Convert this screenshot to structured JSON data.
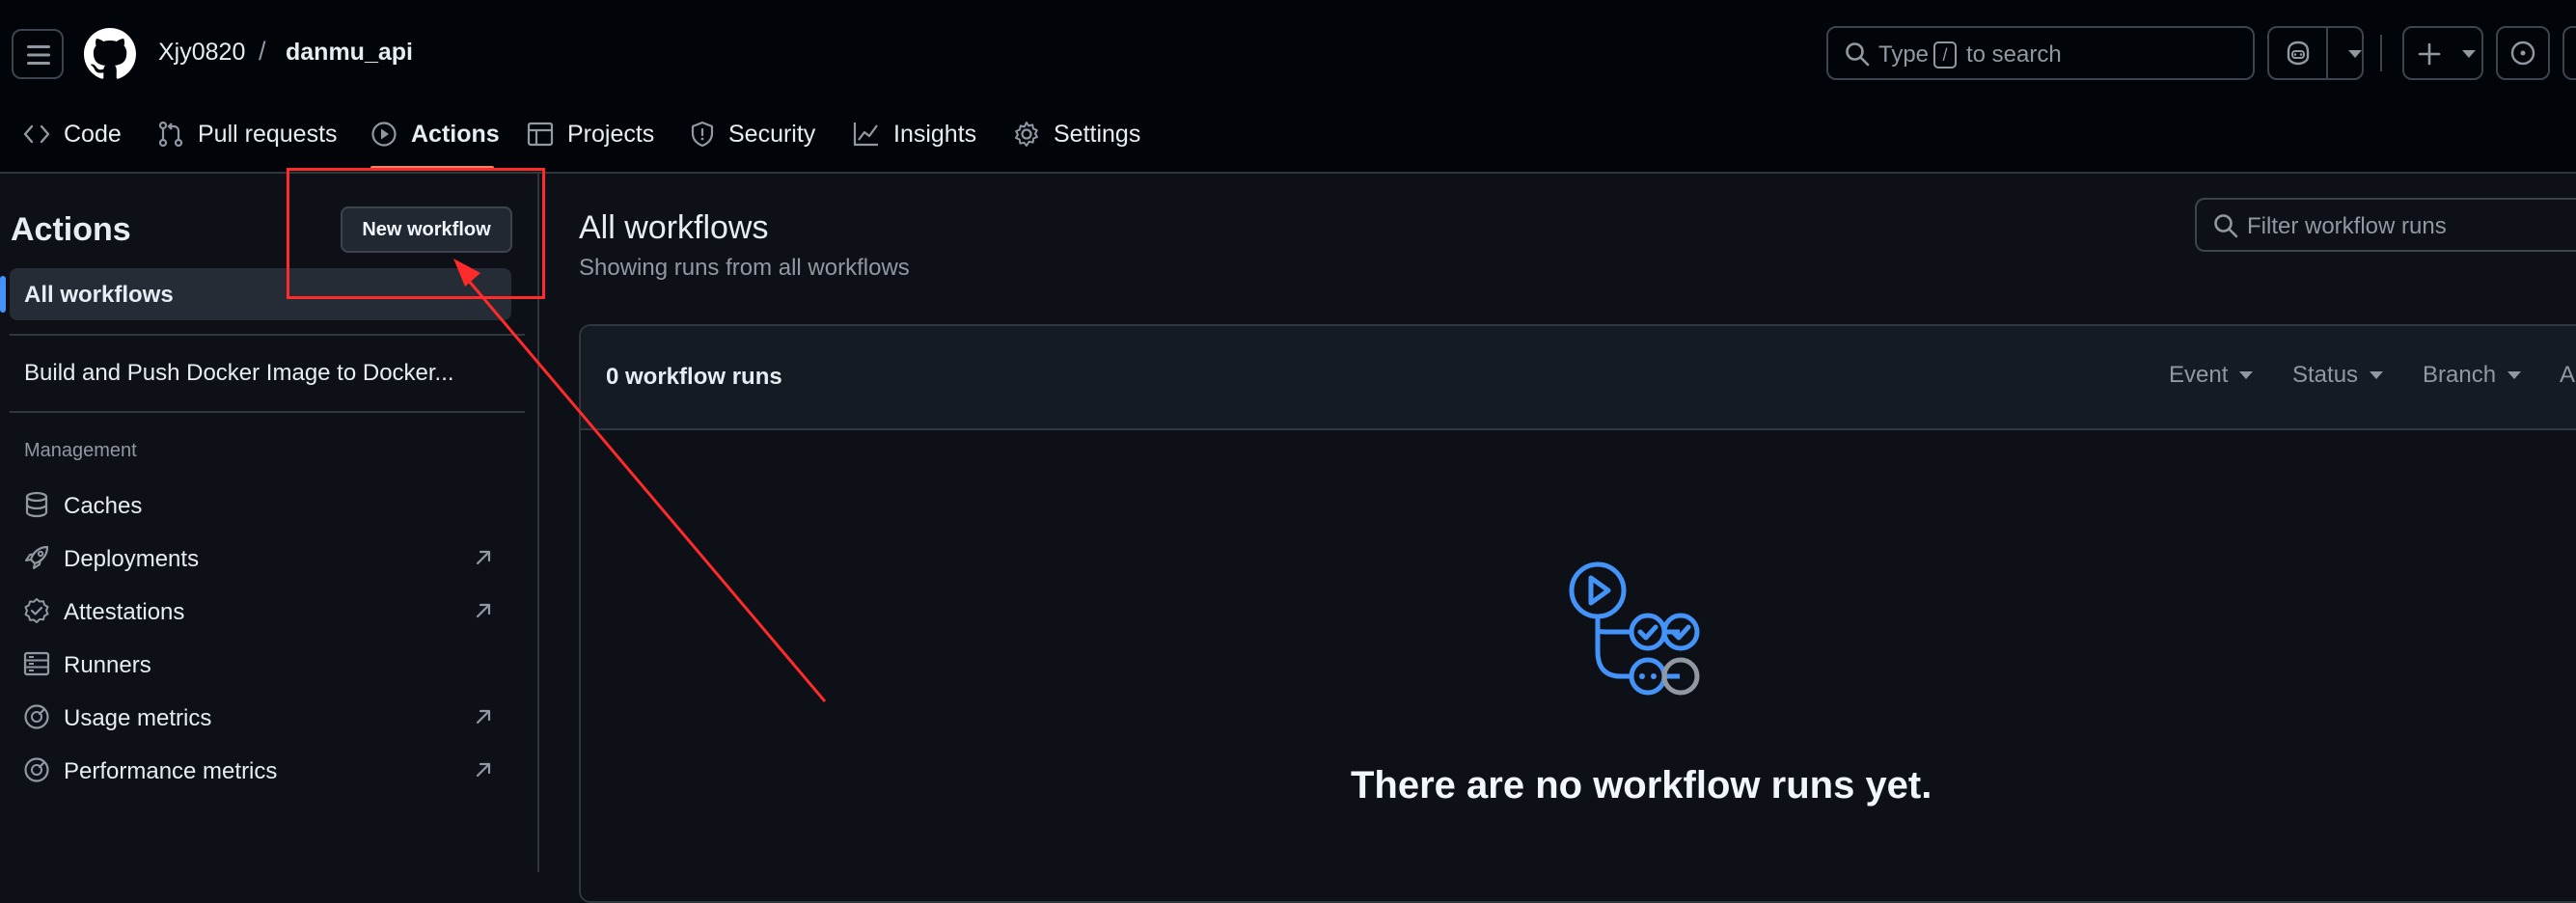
{
  "header": {
    "owner": "Xjy0820",
    "separator": "/",
    "repo": "danmu_api",
    "search_placeholder_pre": "Type",
    "search_key": "/",
    "search_placeholder_post": "to search"
  },
  "repo_nav": {
    "items": [
      {
        "label": "Code",
        "icon": "code-icon"
      },
      {
        "label": "Pull requests",
        "icon": "git-pull-request-icon"
      },
      {
        "label": "Actions",
        "icon": "play-icon",
        "active": true
      },
      {
        "label": "Projects",
        "icon": "table-icon"
      },
      {
        "label": "Security",
        "icon": "shield-icon"
      },
      {
        "label": "Insights",
        "icon": "graph-icon"
      },
      {
        "label": "Settings",
        "icon": "gear-icon"
      }
    ]
  },
  "sidebar": {
    "title": "Actions",
    "new_workflow_label": "New workflow",
    "all_workflows_label": "All workflows",
    "workflow_item": "Build and Push Docker Image to Docker...",
    "management_heading": "Management",
    "management_items": [
      {
        "label": "Caches",
        "icon": "database-icon",
        "external": false
      },
      {
        "label": "Deployments",
        "icon": "rocket-icon",
        "external": true
      },
      {
        "label": "Attestations",
        "icon": "verified-icon",
        "external": true
      },
      {
        "label": "Runners",
        "icon": "server-icon",
        "external": false
      },
      {
        "label": "Usage metrics",
        "icon": "meter-icon",
        "external": true
      },
      {
        "label": "Performance metrics",
        "icon": "meter-icon",
        "external": true
      }
    ]
  },
  "main": {
    "title": "All workflows",
    "subtitle": "Showing runs from all workflows",
    "filter_placeholder": "Filter workflow runs",
    "runs_count": "0 workflow runs",
    "filters": [
      "Event",
      "Status",
      "Branch",
      "A"
    ],
    "empty_message": "There are no workflow runs yet."
  },
  "colors": {
    "accent_blue": "#4493f8",
    "annotation_red": "#ff2a2a",
    "active_tab_underline": "#f78166"
  }
}
